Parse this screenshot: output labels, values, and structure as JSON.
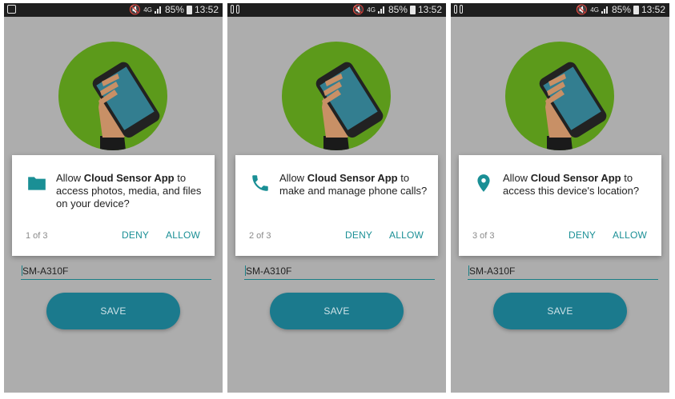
{
  "status_bar": {
    "network_label": "4G",
    "battery_percent": "85%",
    "time": "13:52"
  },
  "dialogs": [
    {
      "icon": "folder-icon",
      "prefix": "Allow ",
      "app_name": "Cloud Sensor App",
      "message": " to access photos, media, and files on your device?",
      "counter": "1 of 3",
      "deny": "DENY",
      "allow": "ALLOW"
    },
    {
      "icon": "phone-icon",
      "prefix": "Allow ",
      "app_name": "Cloud Sensor App",
      "message": " to make and manage phone calls?",
      "counter": "2 of 3",
      "deny": "DENY",
      "allow": "ALLOW"
    },
    {
      "icon": "location-pin-icon",
      "prefix": "Allow ",
      "app_name": "Cloud Sensor App",
      "message": " to access this device's location?",
      "counter": "3 of 3",
      "deny": "DENY",
      "allow": "ALLOW"
    }
  ],
  "form": {
    "device_name_value": "SM-A310F",
    "save_label": "SAVE"
  },
  "colors": {
    "accent": "#1a8f95",
    "save_button": "#1b7a8d",
    "avatar_bg": "#5c9a1b",
    "screen_bg": "#adadad"
  }
}
